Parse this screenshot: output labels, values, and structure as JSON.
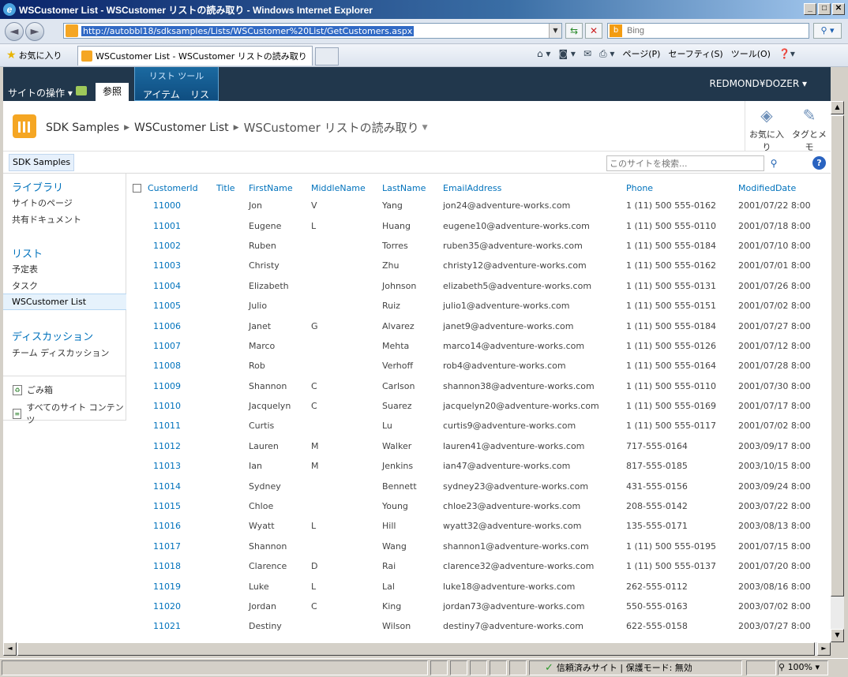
{
  "window": {
    "title": "WSCustomer List - WSCustomer リストの読み取り - Windows Internet Explorer",
    "buttons": [
      "_",
      "□",
      "✕"
    ]
  },
  "address_bar": {
    "url": "http://autobbl18/sdksamples/Lists/WSCustomer%20List/GetCustomers.aspx",
    "search_placeholder": "Bing"
  },
  "favorites_bar": {
    "favorites_label": "お気に入り",
    "tab_title": "WSCustomer List - WSCustomer リストの読み取り"
  },
  "command_bar": {
    "page": "ページ(P)",
    "safety": "セーフティ(S)",
    "tools": "ツール(O)"
  },
  "ribbon": {
    "site_actions": "サイトの操作",
    "browse_tab": "参照",
    "list_tools": "リスト ツール",
    "items_tab": "アイテム",
    "list_tab": "リスト",
    "user": "REDMOND¥DOZER"
  },
  "title_area": {
    "site_name": "SDK Samples",
    "list_name": "WSCustomer List",
    "view_name": "WSCustomer リストの読み取り",
    "like_label": "お気に入り",
    "tags_label": "タグとメモ"
  },
  "top_nav": {
    "home": "SDK Samples",
    "search_placeholder": "このサイトを検索..."
  },
  "quick_launch": {
    "libraries": "ライブラリ",
    "site_pages": "サイトのページ",
    "shared_docs": "共有ドキュメント",
    "lists": "リスト",
    "calendar": "予定表",
    "tasks": "タスク",
    "ws_customer": "WSCustomer List",
    "discussions": "ディスカッション",
    "team_discussion": "チーム ディスカッション",
    "recycle_bin": "ごみ箱",
    "all_content": "すべてのサイト コンテンツ"
  },
  "table": {
    "columns": [
      "CustomerId",
      "Title",
      "FirstName",
      "MiddleName",
      "LastName",
      "EmailAddress",
      "Phone",
      "ModifiedDate"
    ],
    "rows": [
      [
        "11000",
        "",
        "Jon",
        "V",
        "Yang",
        "jon24@adventure-works.com",
        "1 (11) 500 555-0162",
        "2001/07/22 8:00"
      ],
      [
        "11001",
        "",
        "Eugene",
        "L",
        "Huang",
        "eugene10@adventure-works.com",
        "1 (11) 500 555-0110",
        "2001/07/18 8:00"
      ],
      [
        "11002",
        "",
        "Ruben",
        "",
        "Torres",
        "ruben35@adventure-works.com",
        "1 (11) 500 555-0184",
        "2001/07/10 8:00"
      ],
      [
        "11003",
        "",
        "Christy",
        "",
        "Zhu",
        "christy12@adventure-works.com",
        "1 (11) 500 555-0162",
        "2001/07/01 8:00"
      ],
      [
        "11004",
        "",
        "Elizabeth",
        "",
        "Johnson",
        "elizabeth5@adventure-works.com",
        "1 (11) 500 555-0131",
        "2001/07/26 8:00"
      ],
      [
        "11005",
        "",
        "Julio",
        "",
        "Ruiz",
        "julio1@adventure-works.com",
        "1 (11) 500 555-0151",
        "2001/07/02 8:00"
      ],
      [
        "11006",
        "",
        "Janet",
        "G",
        "Alvarez",
        "janet9@adventure-works.com",
        "1 (11) 500 555-0184",
        "2001/07/27 8:00"
      ],
      [
        "11007",
        "",
        "Marco",
        "",
        "Mehta",
        "marco14@adventure-works.com",
        "1 (11) 500 555-0126",
        "2001/07/12 8:00"
      ],
      [
        "11008",
        "",
        "Rob",
        "",
        "Verhoff",
        "rob4@adventure-works.com",
        "1 (11) 500 555-0164",
        "2001/07/28 8:00"
      ],
      [
        "11009",
        "",
        "Shannon",
        "C",
        "Carlson",
        "shannon38@adventure-works.com",
        "1 (11) 500 555-0110",
        "2001/07/30 8:00"
      ],
      [
        "11010",
        "",
        "Jacquelyn",
        "C",
        "Suarez",
        "jacquelyn20@adventure-works.com",
        "1 (11) 500 555-0169",
        "2001/07/17 8:00"
      ],
      [
        "11011",
        "",
        "Curtis",
        "",
        "Lu",
        "curtis9@adventure-works.com",
        "1 (11) 500 555-0117",
        "2001/07/02 8:00"
      ],
      [
        "11012",
        "",
        "Lauren",
        "M",
        "Walker",
        "lauren41@adventure-works.com",
        "717-555-0164",
        "2003/09/17 8:00"
      ],
      [
        "11013",
        "",
        "Ian",
        "M",
        "Jenkins",
        "ian47@adventure-works.com",
        "817-555-0185",
        "2003/10/15 8:00"
      ],
      [
        "11014",
        "",
        "Sydney",
        "",
        "Bennett",
        "sydney23@adventure-works.com",
        "431-555-0156",
        "2003/09/24 8:00"
      ],
      [
        "11015",
        "",
        "Chloe",
        "",
        "Young",
        "chloe23@adventure-works.com",
        "208-555-0142",
        "2003/07/22 8:00"
      ],
      [
        "11016",
        "",
        "Wyatt",
        "L",
        "Hill",
        "wyatt32@adventure-works.com",
        "135-555-0171",
        "2003/08/13 8:00"
      ],
      [
        "11017",
        "",
        "Shannon",
        "",
        "Wang",
        "shannon1@adventure-works.com",
        "1 (11) 500 555-0195",
        "2001/07/15 8:00"
      ],
      [
        "11018",
        "",
        "Clarence",
        "D",
        "Rai",
        "clarence32@adventure-works.com",
        "1 (11) 500 555-0137",
        "2001/07/20 8:00"
      ],
      [
        "11019",
        "",
        "Luke",
        "L",
        "Lal",
        "luke18@adventure-works.com",
        "262-555-0112",
        "2003/08/16 8:00"
      ],
      [
        "11020",
        "",
        "Jordan",
        "C",
        "King",
        "jordan73@adventure-works.com",
        "550-555-0163",
        "2003/07/02 8:00"
      ],
      [
        "11021",
        "",
        "Destiny",
        "",
        "Wilson",
        "destiny7@adventure-works.com",
        "622-555-0158",
        "2003/07/27 8:00"
      ]
    ]
  },
  "status_bar": {
    "trusted": "信頼済みサイト | 保護モード: 無効",
    "zoom": "100%"
  }
}
